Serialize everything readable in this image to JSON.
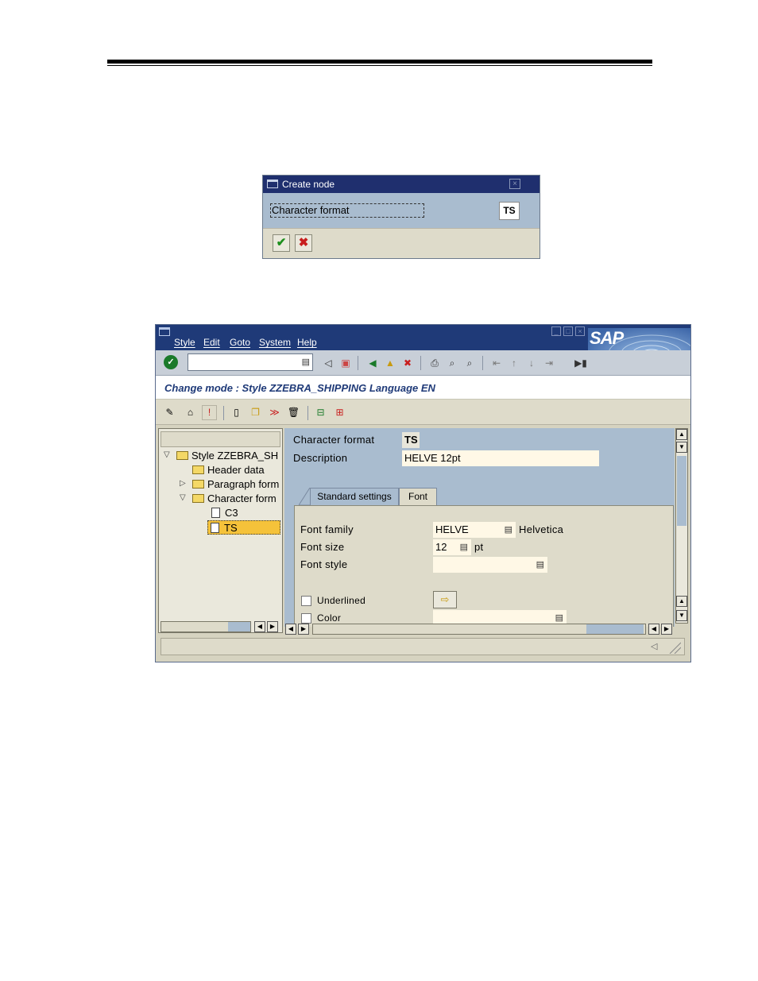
{
  "dialog": {
    "title": "Create node",
    "input_value": "Character format",
    "key": "TS"
  },
  "menu": {
    "items": [
      "Style",
      "Edit",
      "Goto",
      "System",
      "Help"
    ],
    "logo": "SAP"
  },
  "subtitle": "Change mode : Style ZZEBRA_SHIPPING Language EN",
  "tree": {
    "nodes": [
      {
        "label": "Style ZZEBRA_SH"
      },
      {
        "label": "Header data"
      },
      {
        "label": "Paragraph form"
      },
      {
        "label": "Character form"
      },
      {
        "label": "C3"
      },
      {
        "label": "TS"
      }
    ]
  },
  "detail": {
    "char_format_label": "Character format",
    "char_format_value": "TS",
    "description_label": "Description",
    "description_value": "HELVE 12pt",
    "tabs": [
      "Standard settings",
      "Font"
    ],
    "font_family_label": "Font family",
    "font_family_value": "HELVE",
    "font_family_desc": "Helvetica",
    "font_size_label": "Font size",
    "font_size_value": "12",
    "font_size_unit": "pt",
    "font_style_label": "Font style",
    "font_style_value": "",
    "underlined_label": "Underlined",
    "color_label": "Color"
  },
  "colors": {
    "title_bar": "#1f3a78",
    "panel_blue": "#a9bccf",
    "panel_beige": "#dedbca",
    "selected": "#f5c23a"
  }
}
